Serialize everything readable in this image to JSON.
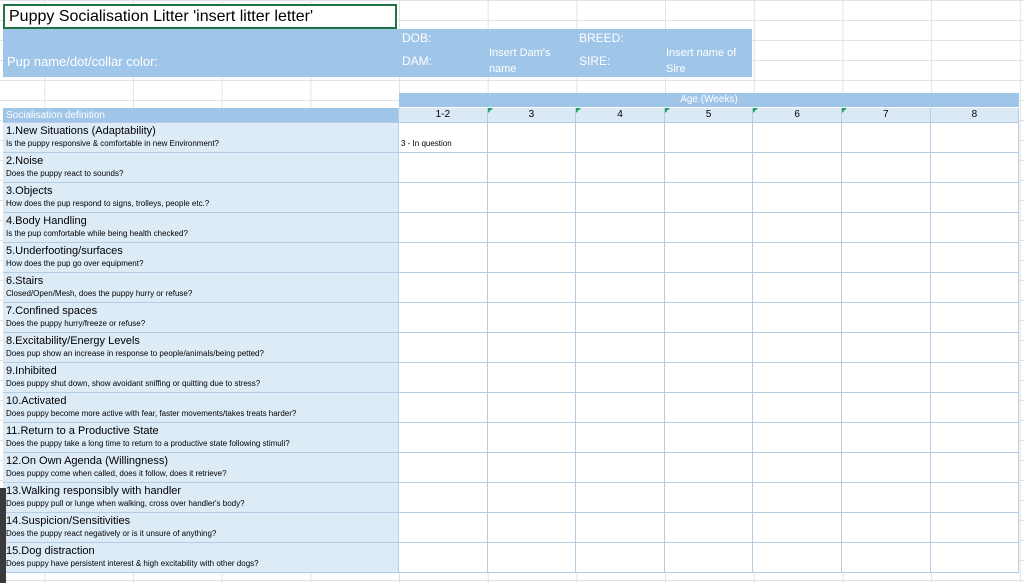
{
  "sheet": {
    "title": "Puppy Socialisation Litter 'insert litter letter'",
    "header": {
      "pup_label": "Pup name/dot/collar color:",
      "dob_label": "DOB:",
      "dam_label": "DAM:",
      "dam_value": "Insert  Dam's name",
      "breed_label": "BREED:",
      "sire_label": "SIRE:",
      "sire_value": "Insert name of Sire"
    },
    "age_header": "Age (Weeks)",
    "col_header": "Socialisation definition",
    "weeks": [
      "1-2",
      "3",
      "4",
      "5",
      "6",
      "7",
      "8"
    ],
    "rows": [
      {
        "title": "1.New Situations (Adaptability)",
        "desc": "Is the puppy responsive & comfortable in new Environment?",
        "entries": [
          "3 - In question",
          "",
          "",
          "",
          "",
          "",
          ""
        ]
      },
      {
        "title": "2.Noise",
        "desc": "Does the puppy react to sounds?",
        "entries": [
          "",
          "",
          "",
          "",
          "",
          "",
          ""
        ]
      },
      {
        "title": "3.Objects",
        "desc": "How does the pup respond to signs, trolleys, people etc.?",
        "entries": [
          "",
          "",
          "",
          "",
          "",
          "",
          ""
        ]
      },
      {
        "title": "4.Body Handling",
        "desc": "Is the pup comfortable while being health checked?",
        "entries": [
          "",
          "",
          "",
          "",
          "",
          "",
          ""
        ]
      },
      {
        "title": "5.Underfooting/surfaces",
        "desc": "How does the pup go over equipment?",
        "entries": [
          "",
          "",
          "",
          "",
          "",
          "",
          ""
        ]
      },
      {
        "title": "6.Stairs",
        "desc": "Closed/Open/Mesh, does the puppy hurry or refuse?",
        "entries": [
          "",
          "",
          "",
          "",
          "",
          "",
          ""
        ]
      },
      {
        "title": "7.Confined spaces",
        "desc": "Does the puppy hurry/freeze or refuse?",
        "entries": [
          "",
          "",
          "",
          "",
          "",
          "",
          ""
        ]
      },
      {
        "title": "8.Excitability/Energy Levels",
        "desc": "Does pup show an increase in response to people/animals/being petted?",
        "entries": [
          "",
          "",
          "",
          "",
          "",
          "",
          ""
        ]
      },
      {
        "title": "9.Inhibited",
        "desc": "Does puppy shut down, show avoidant sniffing or quitting due to stress?",
        "entries": [
          "",
          "",
          "",
          "",
          "",
          "",
          ""
        ]
      },
      {
        "title": "10.Activated",
        "desc": "Does puppy become more active with fear, faster movements/takes treats harder?",
        "entries": [
          "",
          "",
          "",
          "",
          "",
          "",
          ""
        ]
      },
      {
        "title": "11.Return to a Productive State",
        "desc": "Does the puppy take a long time to return to a productive state following stimuli?",
        "entries": [
          "",
          "",
          "",
          "",
          "",
          "",
          ""
        ]
      },
      {
        "title": "12.On Own Agenda (Willingness)",
        "desc": "Does puppy come when called, does it follow, does it retrieve?",
        "entries": [
          "",
          "",
          "",
          "",
          "",
          "",
          ""
        ]
      },
      {
        "title": "13.Walking responsibly with handler",
        "desc": "Does puppy pull or lunge when walking, cross over handler's body?",
        "entries": [
          "",
          "",
          "",
          "",
          "",
          "",
          ""
        ]
      },
      {
        "title": "14.Suspicion/Sensitivities",
        "desc": "Does the puppy react negatively or is it unsure of anything?",
        "entries": [
          "",
          "",
          "",
          "",
          "",
          "",
          ""
        ]
      },
      {
        "title": "15.Dog distraction",
        "desc": "Does puppy have persistent interest & high excitability with other dogs?",
        "entries": [
          "",
          "",
          "",
          "",
          "",
          "",
          ""
        ]
      }
    ],
    "colors": {
      "accent": "#9fc5e8",
      "label_bg": "#ddebf7",
      "selection": "#217346",
      "comment": "#21a366"
    }
  }
}
